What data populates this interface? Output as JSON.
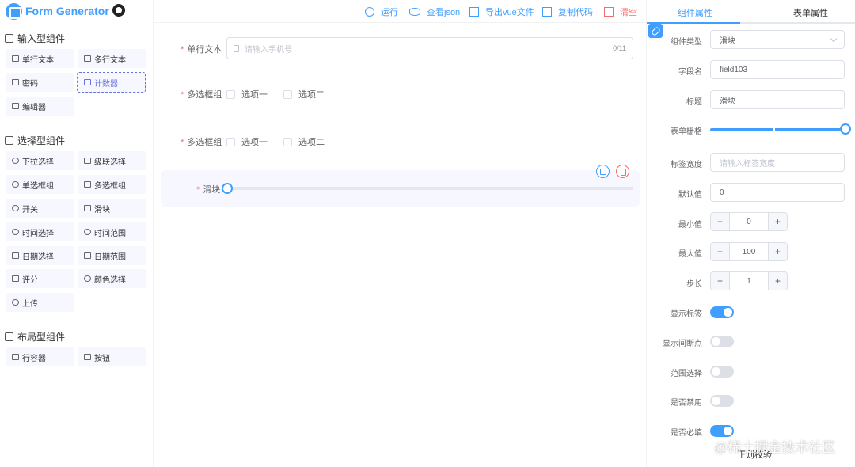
{
  "app": {
    "title": "Form Generator"
  },
  "left": {
    "groups": [
      {
        "title": "输入型组件",
        "items": [
          "单行文本",
          "多行文本",
          "密码",
          "计数器",
          "编辑器"
        ]
      },
      {
        "title": "选择型组件",
        "items": [
          "下拉选择",
          "级联选择",
          "单选框组",
          "多选框组",
          "开关",
          "滑块",
          "时间选择",
          "时间范围",
          "日期选择",
          "日期范围",
          "评分",
          "颜色选择",
          "上传"
        ]
      },
      {
        "title": "布局型组件",
        "items": [
          "行容器",
          "按钮"
        ]
      }
    ]
  },
  "toolbar": {
    "run": "运行",
    "view_json": "查看json",
    "export_vue": "导出vue文件",
    "copy_code": "复制代码",
    "clear": "清空"
  },
  "form": {
    "text_field": {
      "label": "单行文本",
      "placeholder": "请输入手机号",
      "count": "0/11"
    },
    "checkbox_group_1": {
      "label": "多选框组",
      "options": [
        "选项一",
        "选项二"
      ]
    },
    "checkbox_group_2": {
      "label": "多选框组",
      "options": [
        "选项一",
        "选项二"
      ]
    },
    "slider": {
      "label": "滑块",
      "value": 0
    }
  },
  "right": {
    "tabs": [
      "组件属性",
      "表单属性"
    ],
    "props": {
      "component_type_label": "组件类型",
      "component_type_value": "滑块",
      "field_name_label": "字段名",
      "field_name_value": "field103",
      "title_label": "标题",
      "title_value": "滑块",
      "grid_label": "表单栅格",
      "grid_value": 24,
      "label_width_label": "标签宽度",
      "label_width_placeholder": "请输入标签宽度",
      "default_label": "默认值",
      "default_value": "0",
      "min_label": "最小值",
      "min_value": "0",
      "max_label": "最大值",
      "max_value": "100",
      "step_label": "步长",
      "step_value": "1",
      "show_label_label": "显示标签",
      "show_label_on": true,
      "show_stops_label": "显示间断点",
      "show_stops_on": false,
      "range_label": "范围选择",
      "range_on": false,
      "disabled_label": "是否禁用",
      "disabled_on": false,
      "required_label": "是否必填",
      "required_on": true,
      "regex_section": "正则校验"
    }
  },
  "watermark": "@稀土掘金技术社区",
  "colors": {
    "primary": "#409eff",
    "danger": "#f56c6c",
    "accent": "#6673dd"
  }
}
